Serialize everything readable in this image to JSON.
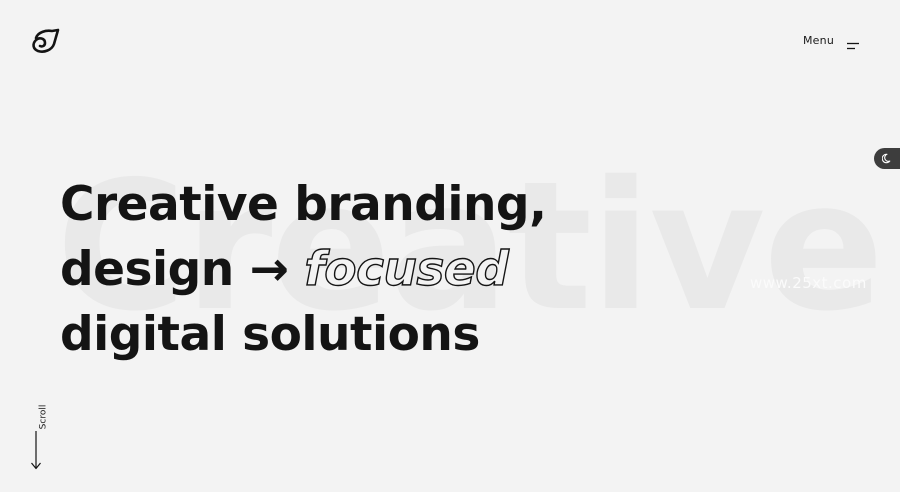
{
  "header": {
    "logo_icon": "brand-logo-icon",
    "menu_label": "Menu",
    "menu_icon": "hamburger-menu-icon"
  },
  "theme_toggle": {
    "icon": "moon-icon"
  },
  "hero": {
    "background_word": "Creative",
    "headline": {
      "line1": "Creative branding,",
      "line2_before": "design",
      "line2_arrow": "→",
      "line2_outlined": "focused",
      "line3": "digital solutions"
    }
  },
  "scroll": {
    "label": "Scroll",
    "icon": "arrow-down-icon"
  },
  "watermark": "www.25xt.com",
  "colors": {
    "background": "#f3f3f3",
    "text": "#141414",
    "background_word": "#e9e9e9",
    "toggle": "#3d3d3d"
  }
}
